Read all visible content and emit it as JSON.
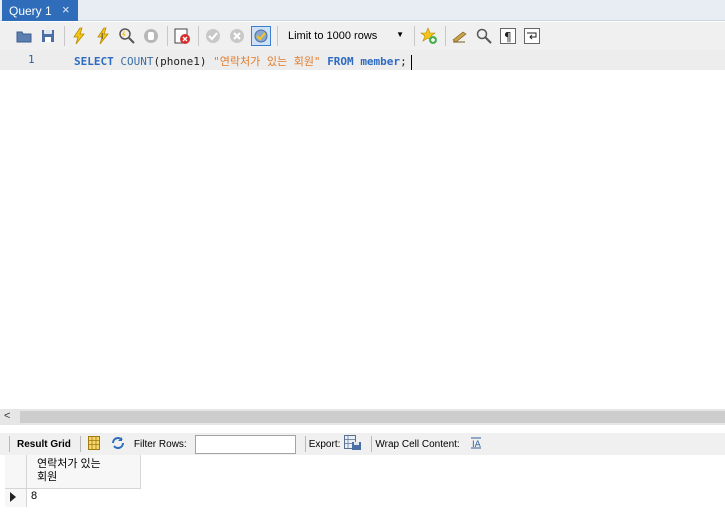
{
  "tab": {
    "label": "Query 1",
    "close_glyph": "×"
  },
  "toolbar": {
    "icons": [
      "open-folder-icon",
      "save-icon",
      "execute-icon",
      "execute-current-icon",
      "explain-icon",
      "stop-icon",
      "toggle-error-icon",
      "commit-icon",
      "rollback-icon",
      "autocommit-icon",
      "limit-dropdown",
      "add-snippet-icon",
      "beautify-icon",
      "find-icon",
      "invisible-chars-icon",
      "word-wrap-icon"
    ],
    "limit_label": "Limit to 1000 rows"
  },
  "editor": {
    "line_number": "1",
    "tokens": {
      "select": "SELECT",
      "count": "COUNT",
      "args": "(phone1) ",
      "alias": "\"연락처가 있는 회원\"",
      "from": "FROM",
      "table": "member",
      "semicolon": ";"
    }
  },
  "result_toolbar": {
    "result_grid": "Result Grid",
    "filter_rows": "Filter Rows:",
    "filter_value": "",
    "export": "Export:",
    "wrap_cell": "Wrap Cell Content:"
  },
  "grid": {
    "column_header_line1": "연락처가 있는",
    "column_header_line2": "회원",
    "rows": [
      {
        "value": "8"
      }
    ]
  },
  "colors": {
    "accent": "#2f6dbb",
    "keyword": "#2d6bc2",
    "string": "#e37c2b"
  }
}
